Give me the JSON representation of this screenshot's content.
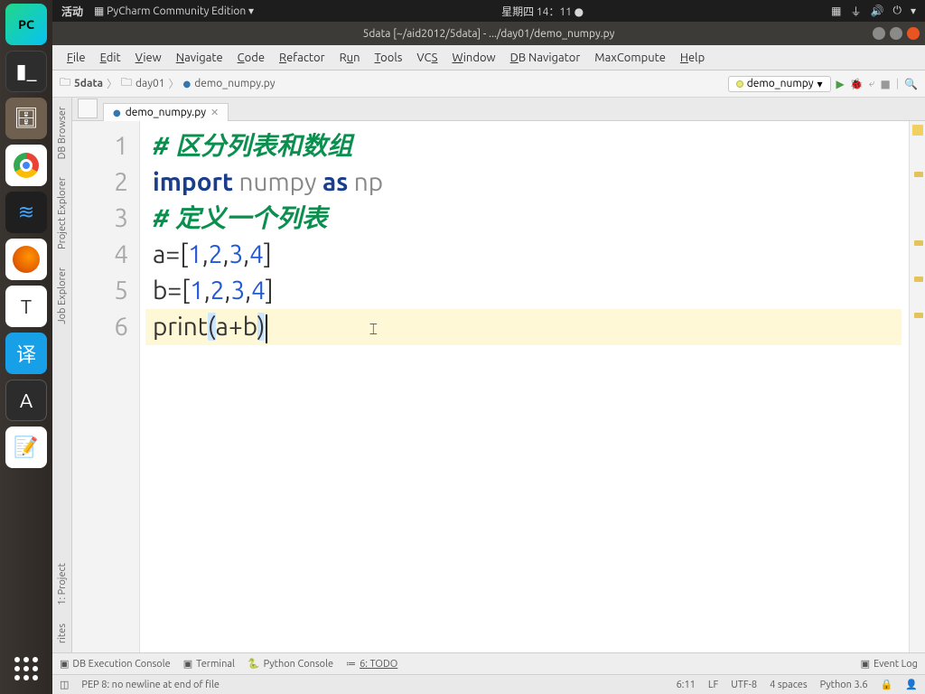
{
  "os_topbar": {
    "activities": "活动",
    "app_title": "PyCharm Community Edition",
    "datetime": "星期四 14：11"
  },
  "window": {
    "title": "5data [~/aid2012/5data] - .../day01/demo_numpy.py"
  },
  "menu": {
    "file": "File",
    "edit": "Edit",
    "view": "View",
    "navigate": "Navigate",
    "code": "Code",
    "refactor": "Refactor",
    "run": "Run",
    "tools": "Tools",
    "vcs": "VCS",
    "window": "Window",
    "db_navigator": "DB Navigator",
    "maxcompute": "MaxCompute",
    "help": "Help"
  },
  "breadcrumbs": {
    "p0": "5data",
    "p1": "day01",
    "p2": "demo_numpy.py"
  },
  "run_config": {
    "name": "demo_numpy"
  },
  "tabs": {
    "file": "demo_numpy.py"
  },
  "side_tools": {
    "db_browser": "DB Browser",
    "project_explorer": "Project Explorer",
    "job_explorer": "Job Explorer",
    "project": "1: Project",
    "favorites": "rites"
  },
  "code": {
    "c1": "#  区分列表和数组",
    "kw_import": "import",
    "mod": "numpy",
    "kw_as": "as",
    "alias": "np",
    "c3": "#  定义一个列表",
    "v_a": "a",
    "v_b": "b",
    "n1": "1",
    "n2": "2",
    "n3": "3",
    "n4": "4",
    "fn_print": "print",
    "varab": "a+b"
  },
  "bottom_tools": {
    "db_exec": "DB Execution Console",
    "terminal": "Terminal",
    "py_console": "Python Console",
    "todo": "6: TODO",
    "event_log": "Event Log"
  },
  "status": {
    "pep8": "PEP 8: no newline at end of file",
    "pos": "6:11",
    "le": "LF",
    "enc": "UTF-8",
    "indent": "4 spaces",
    "py": "Python 3.6"
  }
}
